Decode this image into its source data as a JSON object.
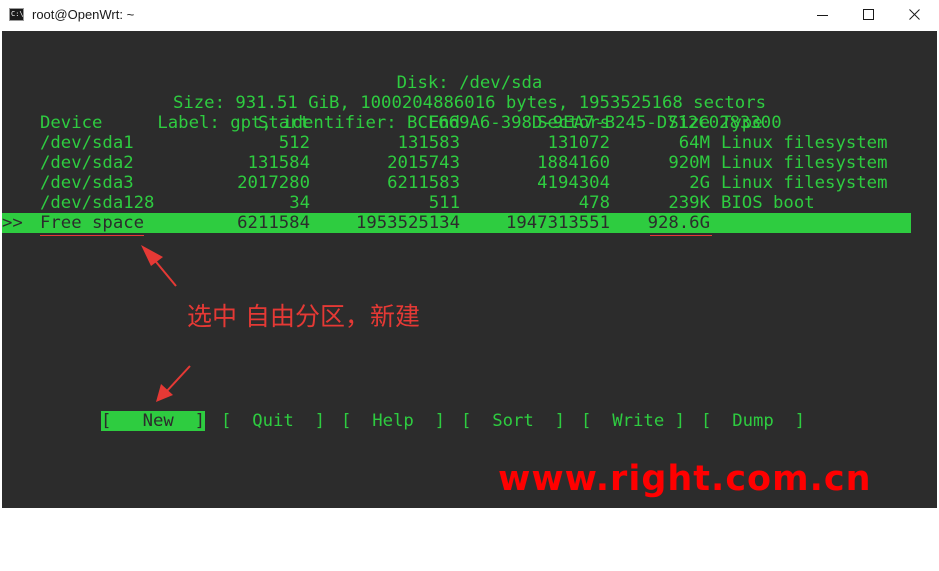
{
  "window": {
    "title": "root@OpenWrt: ~",
    "icon": "terminal-icon",
    "controls": [
      "minimize-icon",
      "maximize-icon",
      "close-icon"
    ]
  },
  "header": {
    "disk": "Disk: /dev/sda",
    "size": "Size: 931.51 GiB, 1000204886016 bytes, 1953525168 sectors",
    "label": "Label: gpt, identifier: BCF669A6-398D-9EA7-B245-D712C0283300"
  },
  "table": {
    "columns": {
      "device": "Device",
      "start": "Start",
      "end": "End",
      "sectors": "Sectors",
      "size": "Size",
      "type": "Type"
    },
    "rows": [
      {
        "device": "/dev/sda1",
        "start": "512",
        "end": "131583",
        "sectors": "131072",
        "size": "64M",
        "type": "Linux filesystem"
      },
      {
        "device": "/dev/sda2",
        "start": "131584",
        "end": "2015743",
        "sectors": "1884160",
        "size": "920M",
        "type": "Linux filesystem"
      },
      {
        "device": "/dev/sda3",
        "start": "2017280",
        "end": "6211583",
        "sectors": "4194304",
        "size": "2G",
        "type": "Linux filesystem"
      },
      {
        "device": "/dev/sda128",
        "start": "34",
        "end": "511",
        "sectors": "478",
        "size": "239K",
        "type": "BIOS boot"
      }
    ],
    "selected": {
      "marker": ">>",
      "device": "Free space",
      "start": "6211584",
      "end": "1953525134",
      "sectors": "1947313551",
      "size": "928.6G",
      "type": ""
    }
  },
  "menu": {
    "new": "[   New  ]",
    "quit": "[  Quit  ]",
    "help": "[  Help  ]",
    "sort": "[  Sort  ]",
    "write": "[  Write ]",
    "dump": "[  Dump  ]"
  },
  "annotation": "选中 自由分区，新建",
  "watermark": "www.right.com.cn",
  "colors": {
    "terminal_bg": "#2c2c2c",
    "terminal_fg": "#2ecc40",
    "annotation": "#e53935",
    "watermark": "#ff0000"
  }
}
